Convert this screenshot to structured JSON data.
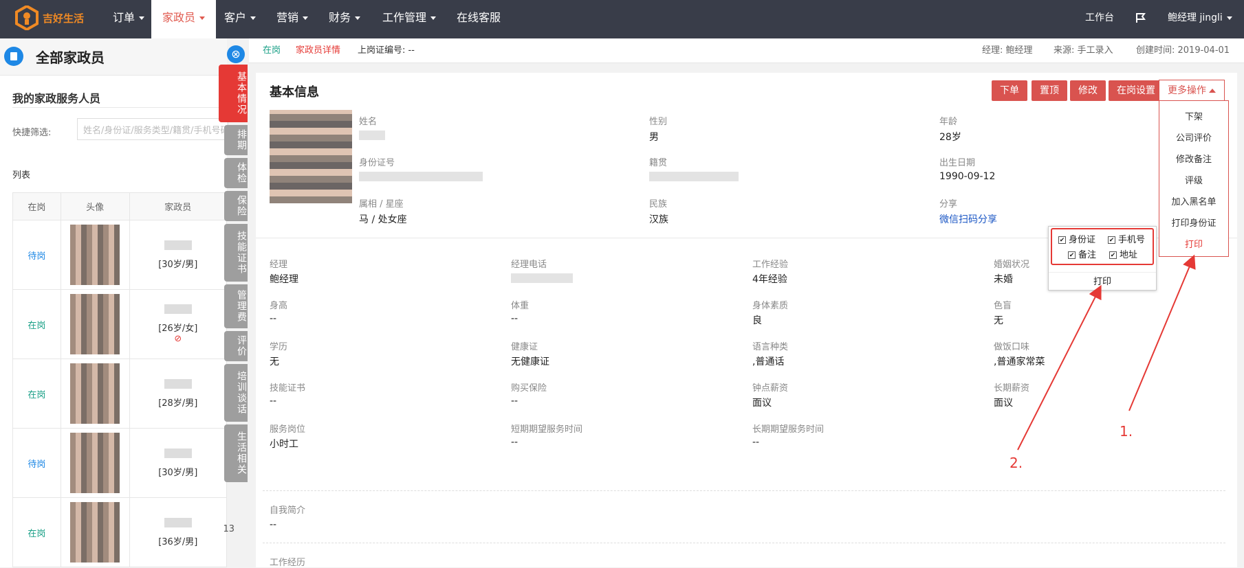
{
  "nav": {
    "brand": "吉好生活",
    "items": [
      {
        "label": "订单",
        "caret": true
      },
      {
        "label": "家政员",
        "caret": true
      },
      {
        "label": "客户",
        "caret": true
      },
      {
        "label": "营销",
        "caret": true
      },
      {
        "label": "财务",
        "caret": true
      },
      {
        "label": "工作管理",
        "caret": true
      },
      {
        "label": "在线客服",
        "caret": false
      }
    ],
    "workbench": "工作台",
    "user": "鲍经理 jingli"
  },
  "sidebar": {
    "header_title": "全部家政员",
    "section_title": "我的家政服务人员",
    "filter_label": "快捷筛选:",
    "filter_placeholder": "姓名/身份证/服务类型/籍贯/手机号码",
    "list_label": "列表",
    "columns": [
      "在岗",
      "头像",
      "家政员"
    ],
    "rows": [
      {
        "status": "待岗",
        "info": "[30岁/男]"
      },
      {
        "status": "在岗",
        "info": "[26岁/女]",
        "banned": "⊘"
      },
      {
        "status": "在岗",
        "info": "[28岁/男]"
      },
      {
        "status": "待岗",
        "info": "[30岁/男]"
      },
      {
        "status": "在岗",
        "info": "[36岁/男]",
        "extra": "13"
      }
    ]
  },
  "vtabs": {
    "close": "⊗",
    "items": [
      "基本情况",
      "排期",
      "体检",
      "保险",
      "技能证书",
      "管理费",
      "评价",
      "培训谈话",
      "生活相关"
    ]
  },
  "infobar": {
    "status": "在岗",
    "detail": "家政员详情",
    "cert": "上岗证编号: --",
    "manager": "经理: 鲍经理",
    "source": "来源: 手工录入",
    "created": "创建时间: 2019-04-01"
  },
  "basic": {
    "title": "基本信息",
    "buttons": [
      "下单",
      "置顶",
      "修改",
      "在岗设置"
    ],
    "more": "更多操作",
    "fields": {
      "name_label": "姓名",
      "gender_label": "性别",
      "gender": "男",
      "age_label": "年龄",
      "age": "28岁",
      "id_label": "身份证号",
      "native_label": "籍贯",
      "birth_label": "出生日期",
      "birth": "1990-09-12",
      "zodiac_label": "属相 / 星座",
      "zodiac": "马 / 处女座",
      "ethnic_label": "民族",
      "ethnic": "汉族",
      "share_label": "分享",
      "share": "微信扫码分享"
    }
  },
  "details": {
    "rows": [
      [
        [
          "经理",
          "鲍经理"
        ],
        [
          "经理电话",
          ""
        ],
        [
          "工作经验",
          "4年经验"
        ],
        [
          "婚姻状况",
          "未婚"
        ]
      ],
      [
        [
          "身高",
          "--"
        ],
        [
          "体重",
          "--"
        ],
        [
          "身体素质",
          "良"
        ],
        [
          "色盲",
          "无"
        ]
      ],
      [
        [
          "学历",
          "无"
        ],
        [
          "健康证",
          "无健康证"
        ],
        [
          "语言种类",
          ",普通话"
        ],
        [
          "做饭口味",
          ",普通家常菜"
        ]
      ],
      [
        [
          "技能证书",
          "--"
        ],
        [
          "购买保险",
          "--"
        ],
        [
          "钟点薪资",
          "面议"
        ],
        [
          "长期薪资",
          "面议"
        ]
      ],
      [
        [
          "服务岗位",
          "小时工"
        ],
        [
          "短期期望服务时间",
          "--"
        ],
        [
          "长期期望服务时间",
          "--"
        ]
      ]
    ],
    "intro_label": "自我简介",
    "intro": "--",
    "history_label": "工作经历",
    "history": "--"
  },
  "dropdown": {
    "items": [
      "下架",
      "公司评价",
      "修改备注",
      "评级",
      "加入黑名单",
      "打印身份证",
      "打印"
    ]
  },
  "popover": {
    "checks": [
      "身份证",
      "手机号",
      "备注",
      "地址"
    ],
    "print": "打印"
  },
  "annotations": {
    "one": "1.",
    "two": "2."
  },
  "colors": {
    "nav_bg": "#393d49",
    "accent_red": "#d9534f",
    "status_green": "#1aa087",
    "status_blue": "#1e88e5",
    "annotation": "#e53935"
  }
}
